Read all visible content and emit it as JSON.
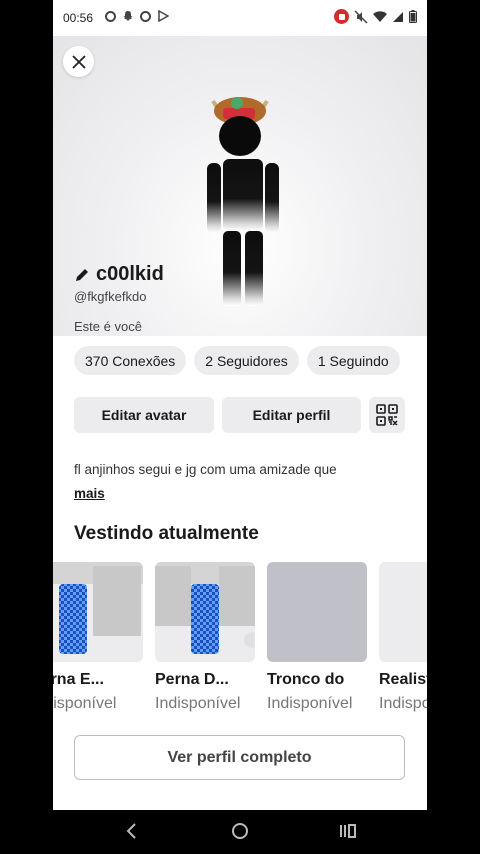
{
  "status_bar": {
    "time": "00:56",
    "icons": [
      "whatsapp-icon",
      "snapchat-icon",
      "camera-record-icon",
      "play-store-icon",
      "screen-record-icon",
      "mute-icon",
      "wifi-icon",
      "signal-icon",
      "battery-icon"
    ]
  },
  "profile": {
    "display_name": "c00lkid",
    "username": "@fkgfkefkdo",
    "this_is_you": "Este é você"
  },
  "stats": {
    "connections": "370 Conexões",
    "followers": "2 Seguidores",
    "following": "1 Seguindo"
  },
  "actions": {
    "edit_avatar": "Editar avatar",
    "edit_profile": "Editar perfil"
  },
  "bio": {
    "text": "fl anjinhos segui e jg com uma amizade que",
    "more": "mais"
  },
  "wearing": {
    "title": "Vestindo atualmente",
    "items": [
      {
        "name": "Perna E...",
        "status": "Indisponível"
      },
      {
        "name": "Perna D...",
        "status": "Indisponível"
      },
      {
        "name": "Tronco do",
        "status": "Indisponível"
      },
      {
        "name": "Realista",
        "status": "Indisponível"
      }
    ]
  },
  "view_full_profile": "Ver perfil completo",
  "colors": {
    "pill_bg": "#ececee",
    "accent_blue": "#2f6fd6"
  }
}
